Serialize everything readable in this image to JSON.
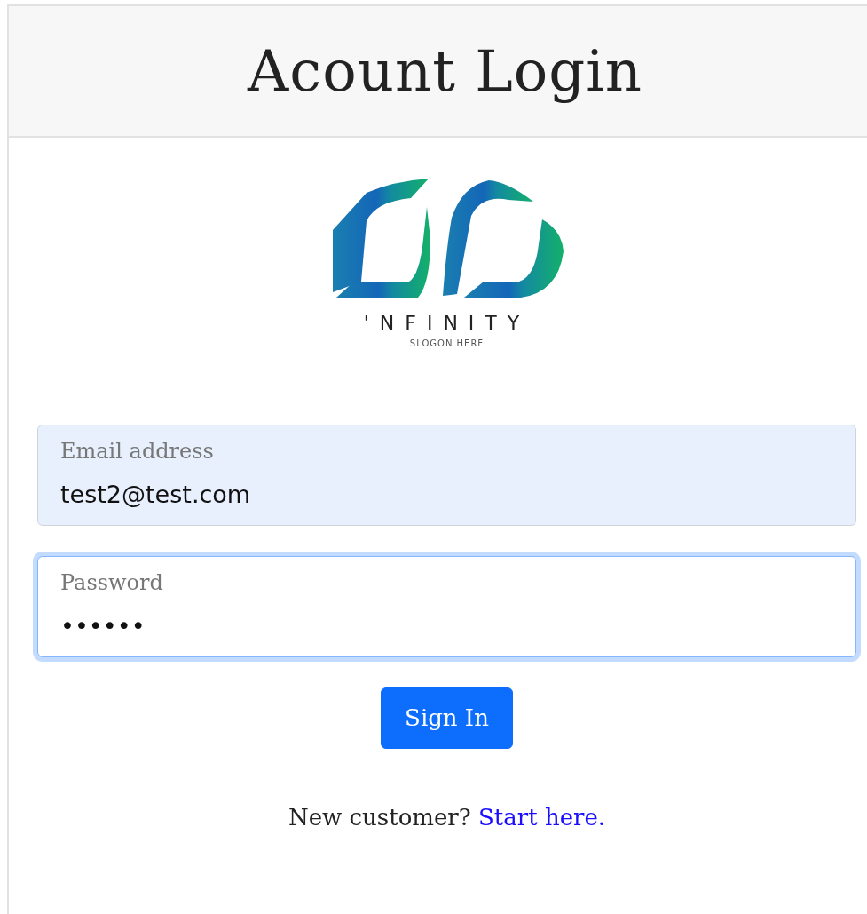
{
  "header": {
    "title": "Acount Login"
  },
  "logo": {
    "name": "'NFINITY",
    "slogan": "SLOGON HERF"
  },
  "fields": [
    {
      "label": "Email address",
      "value": "test2@test.com",
      "autofilled": true,
      "focused": false
    },
    {
      "label": "Password",
      "value": "••••••",
      "autofilled": false,
      "focused": true
    }
  ],
  "submit": {
    "label": "Sign In"
  },
  "footer": {
    "text": "New customer?",
    "link": "Start here."
  }
}
